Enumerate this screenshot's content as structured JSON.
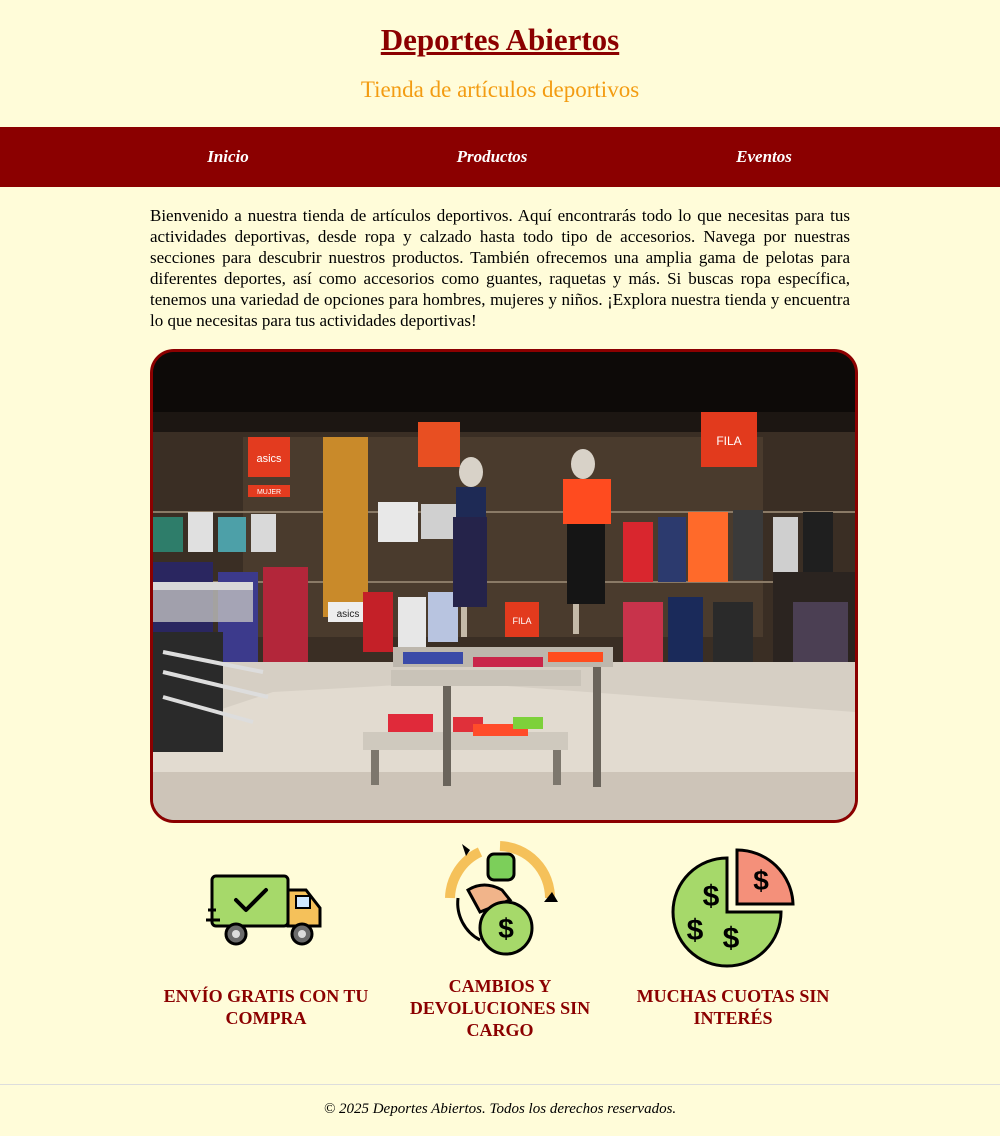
{
  "header": {
    "title": "Deportes Abiertos",
    "subtitle": "Tienda de artículos deportivos"
  },
  "nav": {
    "items": [
      {
        "label": "Inicio"
      },
      {
        "label": "Productos"
      },
      {
        "label": "Eventos"
      }
    ]
  },
  "intro": {
    "text": "Bienvenido a nuestra tienda de artículos deportivos. Aquí encontrarás todo lo que necesitas para tus actividades deportivas, desde ropa y calzado hasta todo tipo de accesorios. Navega por nuestras secciones para descubrir nuestros productos. También ofrecemos una amplia gama de pelotas para diferentes deportes, así como accesorios como guantes, raquetas y más. Si buscas ropa específica, tenemos una variedad de opciones para hombres, mujeres y niños. ¡Explora nuestra tienda y encuentra lo que necesitas para tus actividades deportivas!"
  },
  "hero": {
    "signs": [
      "asics",
      "FILA",
      "MUJER",
      "FILA",
      "asics"
    ]
  },
  "features": [
    {
      "label": "Envío gratis con tu compra",
      "icon": "delivery-truck-icon"
    },
    {
      "label": "Cambios y devoluciones sin cargo",
      "icon": "money-exchange-icon"
    },
    {
      "label": "Muchas cuotas sin interés",
      "icon": "installments-pie-icon"
    }
  ],
  "footer": {
    "text": "© 2025 Deportes Abiertos. Todos los derechos reservados."
  },
  "colors": {
    "background": "#fffcd9",
    "brand": "#8b0000",
    "accent": "#f39c12"
  }
}
